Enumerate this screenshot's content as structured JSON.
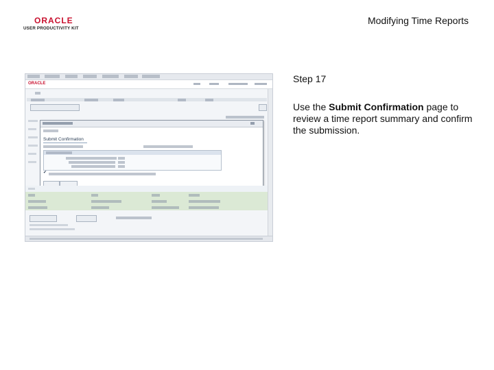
{
  "header": {
    "logo_oracle": "ORACLE",
    "logo_product": "USER PRODUCTIVITY KIT",
    "page_title": "Modifying Time Reports"
  },
  "screenshot": {
    "oracle_label": "ORACLE",
    "modal": {
      "heading": "Submit Confirmation"
    }
  },
  "step": {
    "label": "Step 17",
    "instruction_prefix": "Use the ",
    "instruction_bold": "Submit Confirmation",
    "instruction_suffix": " page to review a time report summary and confirm the submission."
  },
  "colors": {
    "oracle_red": "#c8102e",
    "screenshot_bg": "#f3f5f8"
  }
}
